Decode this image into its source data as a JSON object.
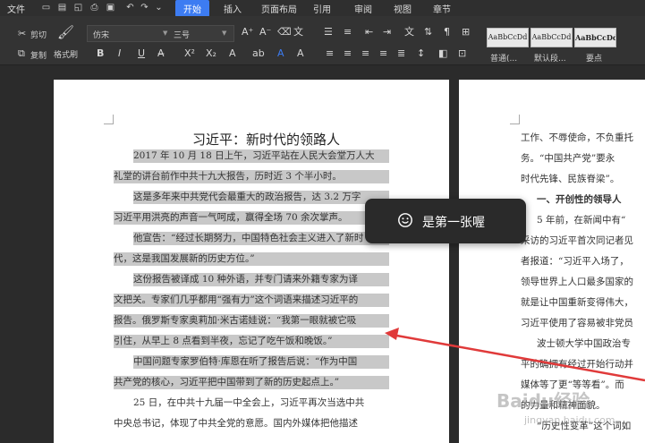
{
  "menu": {
    "file": "文件"
  },
  "tabs": [
    "开始",
    "插入",
    "页面布局",
    "引用",
    "审阅",
    "视图",
    "章节"
  ],
  "active_tab": "开始",
  "ribbon": {
    "cut": "剪切",
    "copy": "复制",
    "format_painter": "格式刷",
    "font_name": "仿宋",
    "font_size": "三号",
    "styles": [
      {
        "preview": "AaBbCcDd",
        "label": "普通(..."
      },
      {
        "preview": "AaBbCcDd",
        "label": "默认段..."
      },
      {
        "preview": "AaBbCcDd",
        "label": "要点"
      }
    ]
  },
  "document": {
    "title": "习近平：新时代的领路人",
    "lines": [
      {
        "text": "2017 年 10 月 18 日上午，习近平站在人民大会堂万人大",
        "hl": true
      },
      {
        "text": "礼堂的讲台前作中共十九大报告，历时近 3 个半小时。",
        "hl": true
      },
      {
        "text": "这是多年来中共党代会最重大的政治报告，达 3.2 万字",
        "hl": true
      },
      {
        "text": "习近平用洪亮的声音一气呵成，赢得全场 70 余次掌声。",
        "hl": true
      },
      {
        "text": "他宣告：“经过长期努力，中国特色社会主义进入了新时",
        "hl": true
      },
      {
        "text": "代，这是我国发展新的历史方位。”",
        "hl": true
      },
      {
        "text": "这份报告被译成 10 种外语，并专门请来外籍专家为译",
        "hl": true
      },
      {
        "text": "文把关。专家们几乎都用“强有力”这个词语来描述习近平的",
        "hl": true
      },
      {
        "text": "报告。俄罗斯专家奥莉加·米古诺娃说：“我第一眼就被它吸",
        "hl": true
      },
      {
        "text": "引住，从早上 8 点看到半夜，忘记了吃午饭和晚饭。”",
        "hl": true
      },
      {
        "text": "中国问题专家罗伯特·库恩在听了报告后说：“作为中国",
        "hl": true
      },
      {
        "text": "共产党的核心，习近平把中国带到了新的历史起点上。”",
        "hl": true
      },
      {
        "text": "25 日，在中共十九届一中全会上，习近平再次当选中共",
        "hl": false
      },
      {
        "text": "中央总书记，体现了中共全党的意愿。国内外媒体把他描述",
        "hl": false
      }
    ],
    "page2_lines": [
      "工作、不辱使命，不负重托",
      "务。“中国共产党”要永",
      "时代先锋、民族脊梁”。",
      "一、开创性的领导人",
      "5 年前，在新闻中有“",
      "采访的习近平首次同记者见",
      "者报道：“习近平入场了，",
      "领导世界上人口最多国家的",
      "就是让中国重新变得伟大，",
      "习近平使用了容易被非党员",
      "波士顿大学中国政治专",
      "平的确拥有经过开始行动并",
      "媒体等了更“等等看”。而",
      "的力量和精神面貌。",
      "“历史性变革”这个词如"
    ]
  },
  "toast": {
    "text": "是第一张喔"
  },
  "watermark": {
    "brand": "Baidu经验",
    "url": "jingyan.baidu.com"
  }
}
